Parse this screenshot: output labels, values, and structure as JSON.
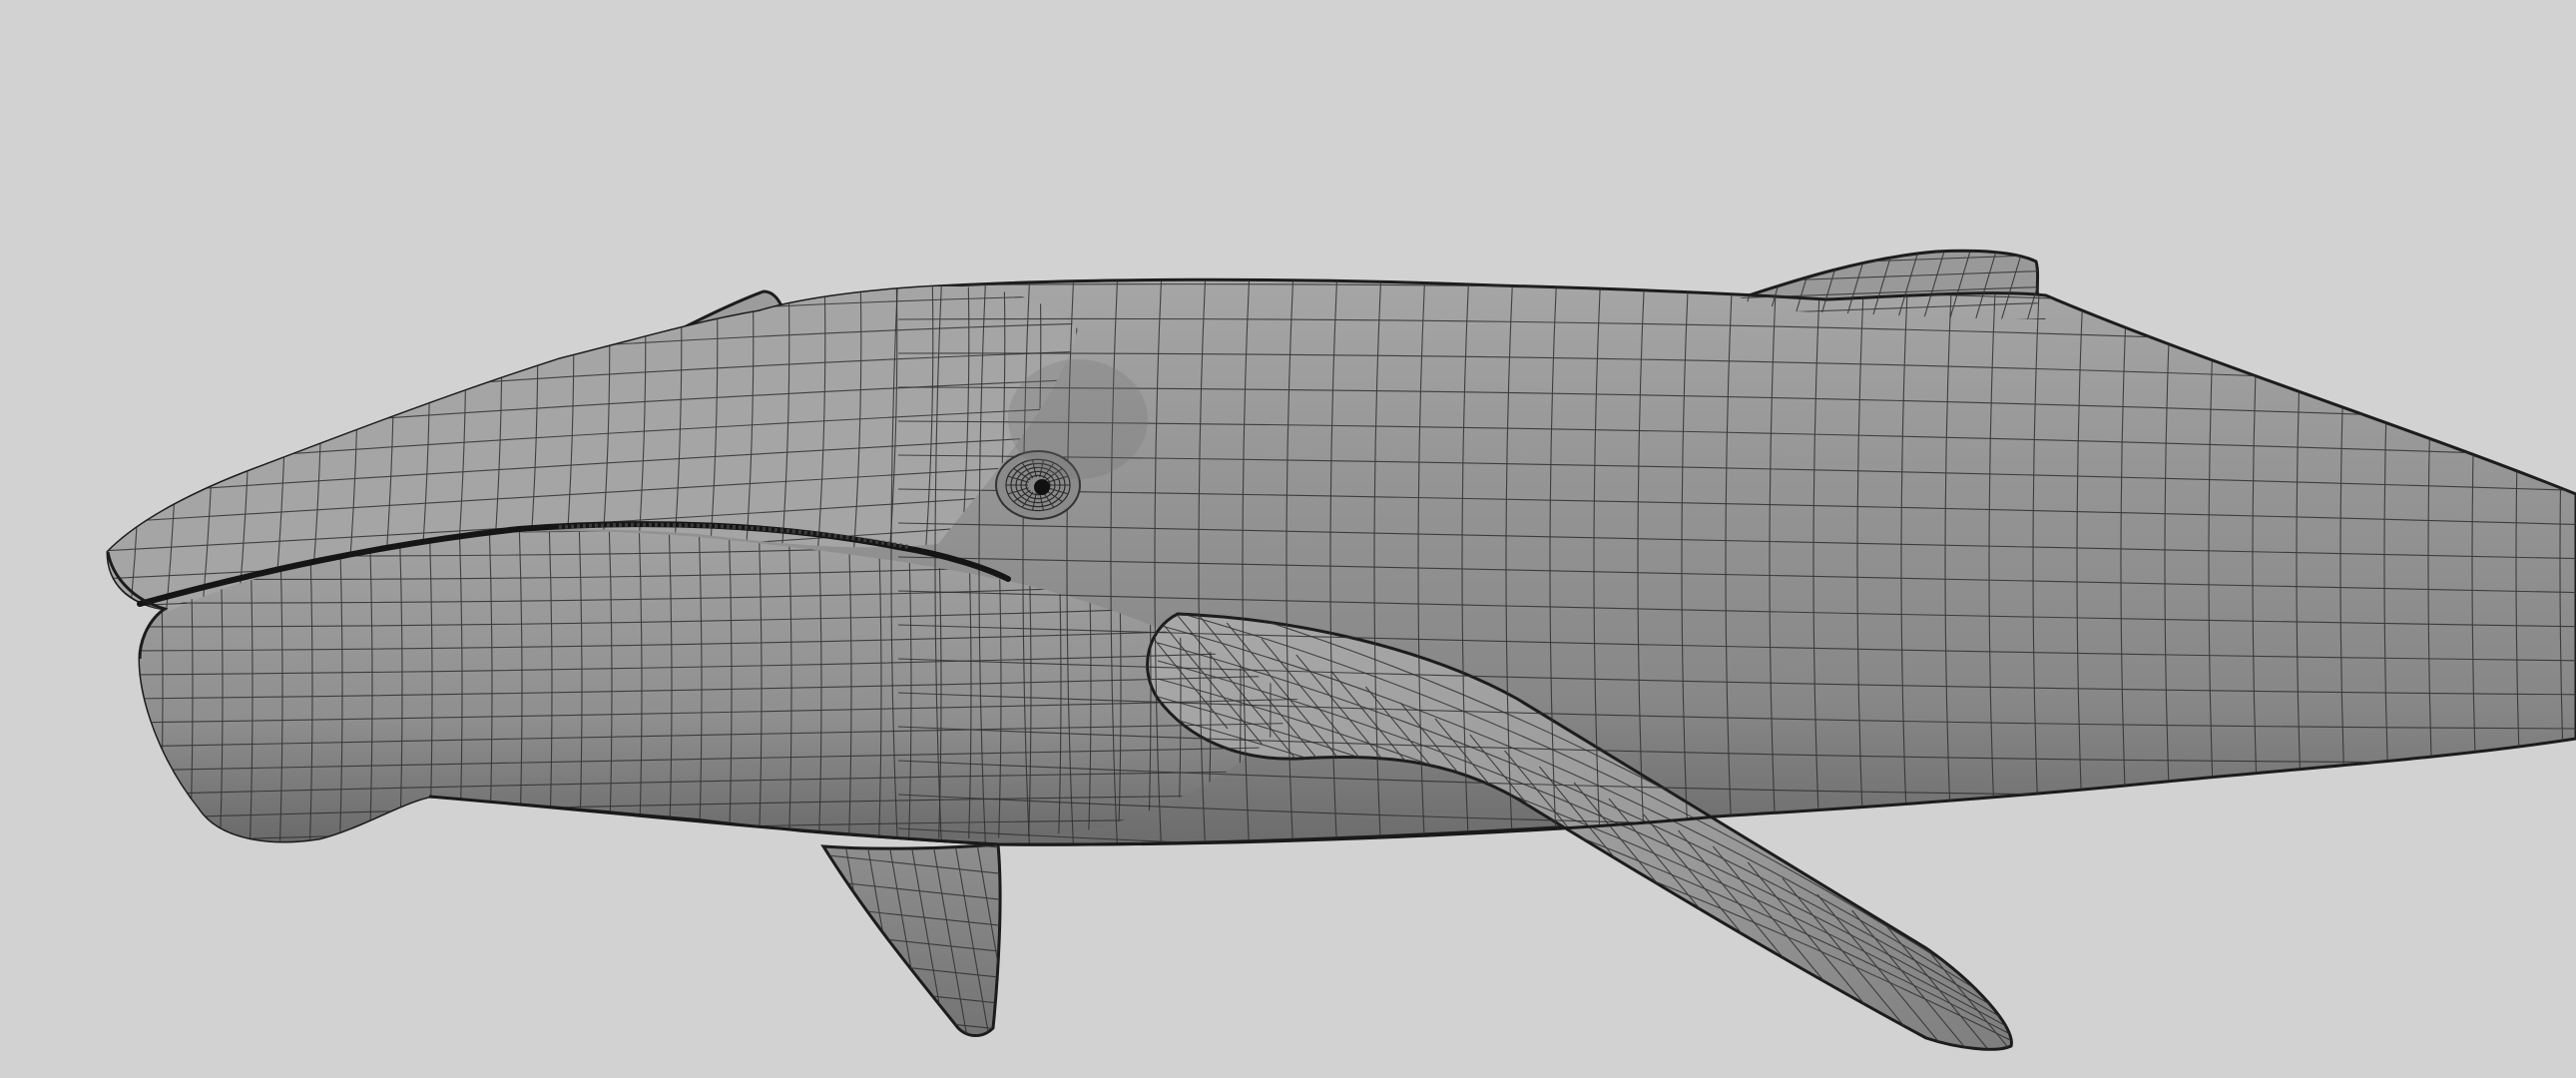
{
  "scene": {
    "subject": "whale-wireframe-model",
    "colors": {
      "background": "#d2d2d2",
      "body": "#8c8c8c",
      "body_light": "#b4b4b4",
      "body_dark": "#5e5e5e",
      "wire": "#2e2e2e",
      "outline": "#1c1c1c"
    }
  }
}
